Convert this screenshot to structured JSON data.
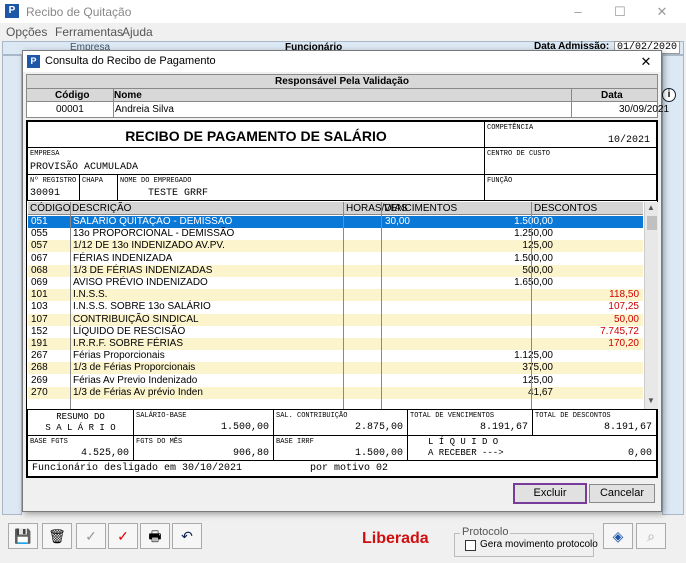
{
  "main": {
    "title": "Recibo de Quitação",
    "menu": [
      "Opções",
      "Ferramentas",
      "Ajuda"
    ],
    "bg_labels": {
      "empresa": "Empresa",
      "funcionario": "Funcionário",
      "data_admissao_label": "Data Admissão:",
      "data_admissao": "01/02/2020"
    },
    "liberada": "Liberada",
    "protocolo": {
      "title": "Protocolo",
      "checkbox_label": "Gera movimento protocolo"
    }
  },
  "dialog": {
    "title": "Consulta do Recibo de Pagamento",
    "validation": {
      "header": "Responsável Pela Validação",
      "col_codigo": "Código",
      "col_nome": "Nome",
      "col_data": "Data",
      "codigo": "00001",
      "nome": "Andreia Silva",
      "data": "30/09/2021"
    },
    "receipt": {
      "title": "RECIBO DE PAGAMENTO DE SALÁRIO",
      "competencia_label": "COMPETÊNCIA",
      "competencia": "10/2021",
      "empresa_label": "EMPRESA",
      "empresa": "PROVISÃO ACUMULADA",
      "centro_custo_label": "CENTRO DE CUSTO",
      "registro_label": "Nº REGISTRO",
      "registro": "30091",
      "chapa_label": "CHAPA",
      "nome_label": "NOME DO EMPREGADO",
      "nome": "TESTE GRRF",
      "funcao_label": "FUNÇÃO",
      "columns": [
        "CÓDIGO",
        "DESCRIÇÃO",
        "HORAS/DIAS",
        "VENCIMENTOS",
        "DESCONTOS"
      ],
      "rows": [
        {
          "codigo": "051",
          "descricao": "SALÁRIO QUITAÇÃO - DEMISSÃO",
          "horas": "30,00",
          "venc": "1.500,00",
          "desc": ""
        },
        {
          "codigo": "055",
          "descricao": "13o PROPORCIONAL - DEMISSÃO",
          "horas": "",
          "venc": "1.250,00",
          "desc": ""
        },
        {
          "codigo": "057",
          "descricao": "1/12 DE 13o INDENIZADO AV.PV.",
          "horas": "",
          "venc": "125,00",
          "desc": ""
        },
        {
          "codigo": "067",
          "descricao": "FÉRIAS INDENIZADA",
          "horas": "",
          "venc": "1.500,00",
          "desc": ""
        },
        {
          "codigo": "068",
          "descricao": "1/3 DE FÉRIAS INDENIZADAS",
          "horas": "",
          "venc": "500,00",
          "desc": ""
        },
        {
          "codigo": "069",
          "descricao": "AVISO PRÉVIO INDENIZADO",
          "horas": "",
          "venc": "1.650,00",
          "desc": ""
        },
        {
          "codigo": "101",
          "descricao": "I.N.S.S.",
          "horas": "",
          "venc": "",
          "desc": "118,50"
        },
        {
          "codigo": "103",
          "descricao": "I.N.S.S. SOBRE 13o SALÁRIO",
          "horas": "",
          "venc": "",
          "desc": "107,25"
        },
        {
          "codigo": "107",
          "descricao": "CONTRIBUIÇÃO SINDICAL",
          "horas": "",
          "venc": "",
          "desc": "50,00"
        },
        {
          "codigo": "152",
          "descricao": "LÍQUIDO DE RESCISÃO",
          "horas": "",
          "venc": "",
          "desc": "7.745,72"
        },
        {
          "codigo": "191",
          "descricao": "I.R.R.F. SOBRE FÉRIAS",
          "horas": "",
          "venc": "",
          "desc": "170,20"
        },
        {
          "codigo": "267",
          "descricao": "Férias Proporcionais",
          "horas": "",
          "venc": "1.125,00",
          "desc": ""
        },
        {
          "codigo": "268",
          "descricao": "1/3 de Férias Proporcionais",
          "horas": "",
          "venc": "375,00",
          "desc": ""
        },
        {
          "codigo": "269",
          "descricao": "Férias Av Previo Indenizado",
          "horas": "",
          "venc": "125,00",
          "desc": ""
        },
        {
          "codigo": "270",
          "descricao": "1/3 de Férias Av prévio Inden",
          "horas": "",
          "venc": "41,67",
          "desc": ""
        }
      ],
      "resumo_line1": "RESUMO DO",
      "resumo_line2": "S A L Á R I O",
      "salario_base_label": "SALÁRIO-BASE",
      "salario_base": "1.500,00",
      "sal_contribuicao_label": "SAL. CONTRIBUIÇÃO",
      "sal_contribuicao": "2.875,00",
      "total_vencimentos_label": "TOTAL DE VENCIMENTOS",
      "total_vencimentos": "8.191,67",
      "total_descontos_label": "TOTAL DE DESCONTOS",
      "total_descontos": "8.191,67",
      "base_fgts_label": "BASE FGTS",
      "base_fgts": "4.525,00",
      "fgts_mes_label": "FGTS DO MÊS",
      "fgts_mes": "906,80",
      "base_irrf_label": "BASE IRRF",
      "base_irrf": "1.500,00",
      "liquido_line1": "L Í Q U I D O",
      "liquido_line2": "A RECEBER --->",
      "liquido": "0,00",
      "footer_left": "Funcionário desligado em 30/10/2021",
      "footer_right": "por motivo 02"
    },
    "buttons": {
      "excluir": "Excluir",
      "cancelar": "Cancelar"
    }
  },
  "colors": {
    "selection": "#0a78d7",
    "row_even": "#fbf4cc",
    "negative": "#d00000",
    "liberada": "#d01010"
  }
}
